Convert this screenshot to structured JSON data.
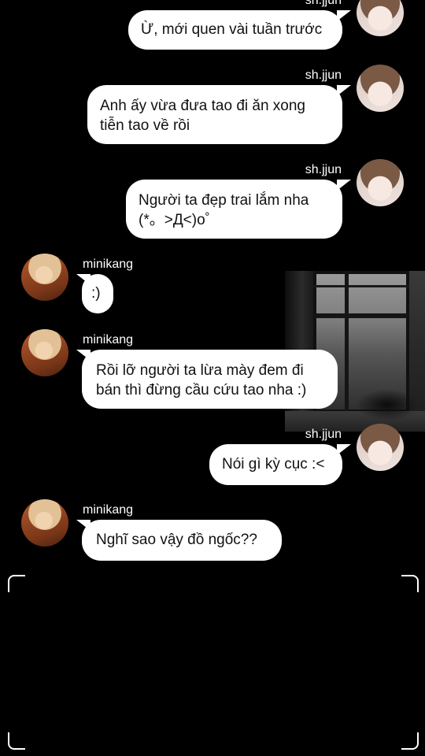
{
  "messages": [
    {
      "sender": "sh.jjun",
      "text": "Ừ, mới quen vài tuần trước"
    },
    {
      "sender": "sh.jjun",
      "text": "Anh ấy vừa đưa tao đi ăn xong\ntiễn tao về rồi"
    },
    {
      "sender": "sh.jjun",
      "text": "Người ta đẹp trai lắm nha\n(*。>Д<)o゜"
    },
    {
      "sender": "minikang",
      "text": ":)"
    },
    {
      "sender": "minikang",
      "text": "Rồi lỡ người ta lừa mày đem đi\nbán thì đừng cầu cứu tao nha :)"
    },
    {
      "sender": "sh.jjun",
      "text": "Nói gì kỳ cục :<"
    },
    {
      "sender": "minikang",
      "text": "Nghĩ sao vậy đồ ngốc??"
    }
  ],
  "colors": {
    "background": "#000000",
    "bubble": "#ffffff",
    "text": "#111111"
  }
}
